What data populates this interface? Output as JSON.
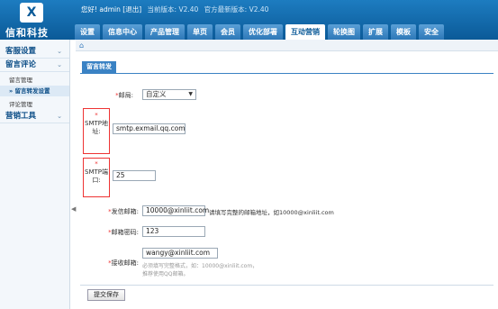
{
  "header": {
    "logo_mark": "X",
    "logo_text": "信和科技",
    "greeting": "您好! admin",
    "logout": "[退出]",
    "current_version": "当前版本: V2.40",
    "latest_version": "官方最新版本: V2.40"
  },
  "nav": {
    "tabs": [
      {
        "label": "设置"
      },
      {
        "label": "信息中心"
      },
      {
        "label": "产品管理"
      },
      {
        "label": "单页"
      },
      {
        "label": "会员"
      },
      {
        "label": "优化部署"
      },
      {
        "label": "互动营销",
        "active": true
      },
      {
        "label": "轮换图"
      },
      {
        "label": "扩展"
      },
      {
        "label": "模板"
      },
      {
        "label": "安全"
      }
    ]
  },
  "sidebar": {
    "groups": [
      {
        "label": "客服设置",
        "items": []
      },
      {
        "label": "留言评论",
        "items": [
          "留言管理",
          "» 留言转发设置",
          "评论管理"
        ]
      },
      {
        "label": "营销工具",
        "items": []
      }
    ]
  },
  "panel": {
    "tab_label": "留言转发"
  },
  "form": {
    "mailbox_label": "邮局:",
    "mailbox_value": "自定义",
    "smtp_addr_label": "SMTP地址:",
    "smtp_addr_value": "smtp.exmail.qq.com",
    "smtp_port_label": "SMTP端口:",
    "smtp_port_value": "25",
    "sender_label": "发信邮箱:",
    "sender_value": "10000@xinliit.com",
    "sender_hint": "请填写完整的邮箱地址，如10000@xinliit.com",
    "password_label": "邮箱密码:",
    "password_value": "123",
    "receiver_label": "接收邮箱:",
    "receiver_value": "wangy@xinliit.com",
    "receiver_hint1": "必须填写完整格式，如：10000@xinliit.com，",
    "receiver_hint2": "推荐使用QQ邮箱。",
    "required_mark": "*",
    "submit_label": "提交保存"
  }
}
